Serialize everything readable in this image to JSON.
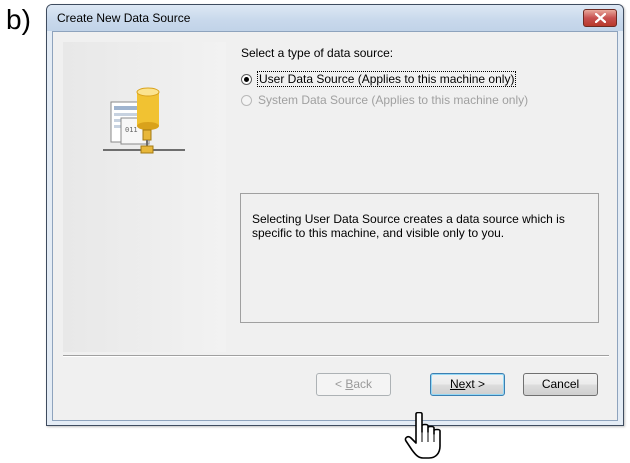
{
  "figure_label": "b)",
  "window": {
    "title": "Create New Data Source"
  },
  "prompt": "Select a type of data source:",
  "options": [
    {
      "label": "User Data Source (Applies to this machine only)",
      "selected": true,
      "enabled": true
    },
    {
      "label": "System Data Source (Applies to this machine only)",
      "selected": false,
      "enabled": false
    }
  ],
  "description": "Selecting User Data Source creates a data source which is specific to this machine, and visible only to you.",
  "buttons": {
    "back_prefix": "< ",
    "back_mnemonic": "B",
    "back_rest": "ack",
    "next_mnemonic": "Ne",
    "next_rest": "xt >",
    "cancel": "Cancel"
  },
  "icons": {
    "wizard": "database-network-icon",
    "close": "close-icon",
    "cursor": "hand-pointer-icon"
  },
  "colors": {
    "close_button": "#c75050",
    "titlebar": "#c9d9ec"
  }
}
